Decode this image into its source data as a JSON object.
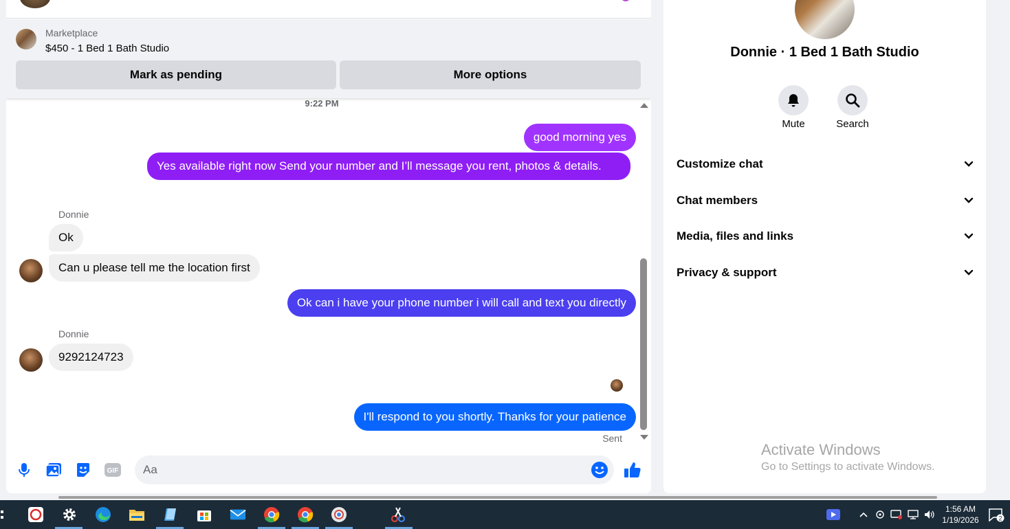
{
  "marketplace": {
    "label": "Marketplace",
    "title": "$450 - 1 Bed 1 Bath Studio",
    "pending_button": "Mark as pending",
    "more_button": "More options"
  },
  "messages": {
    "timestamp": "9:22 PM",
    "items": [
      {
        "direction": "out",
        "text": "good morning yes",
        "color": "#a033ff"
      },
      {
        "direction": "out",
        "text": "Yes available right now Send your number and I’ll message you rent, photos & details.",
        "color": "#8f1ef5"
      },
      {
        "direction": "in",
        "sender": "Donnie",
        "text": "Ok"
      },
      {
        "direction": "in",
        "text": "Can u please tell me the location first"
      },
      {
        "direction": "out",
        "text": "Ok can i have your phone number i will call and text you directly",
        "color": "#4b3ff0"
      },
      {
        "direction": "in",
        "sender": "Donnie",
        "text": "9292124723"
      },
      {
        "direction": "out",
        "text": "I'll respond to you shortly. Thanks for your patience",
        "color": "#0866ff"
      }
    ],
    "status": "Sent"
  },
  "composer": {
    "placeholder": "Aa",
    "icons": [
      "microphone-icon",
      "image-icon",
      "sticker-icon",
      "gif-icon",
      "emoji-icon",
      "thumbs-up-icon"
    ]
  },
  "info": {
    "name": "Donnie · 1 Bed 1 Bath Studio",
    "mute_label": "Mute",
    "search_label": "Search",
    "sections": [
      "Customize chat",
      "Chat members",
      "Media, files and links",
      "Privacy & support"
    ]
  },
  "watermark": {
    "title": "Activate Windows",
    "subtitle": "Go to Settings to activate Windows."
  },
  "taskbar": {
    "time": "1:56 AM",
    "date": "1/19/2026",
    "notification_count": "2"
  },
  "colors": {
    "accent": "#0866ff",
    "composer_icon": "#0866ff"
  }
}
